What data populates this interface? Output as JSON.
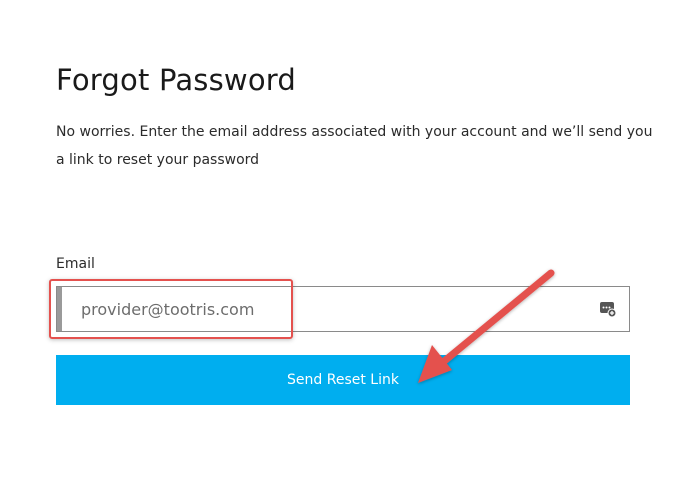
{
  "header": {
    "title": "Forgot Password",
    "description": "No worries. Enter the email address associated with your account and we’ll send you a link to reset your password"
  },
  "form": {
    "email_label": "Email",
    "email_value": "provider@tootris.com",
    "email_placeholder": "",
    "password_manager_icon": "password-manager-icon",
    "submit_label": "Send Reset Link"
  },
  "annotations": {
    "highlight_color": "#e4514e",
    "arrow_color": "#e4514e"
  },
  "colors": {
    "button_bg": "#00aeef",
    "button_text": "#ffffff"
  }
}
